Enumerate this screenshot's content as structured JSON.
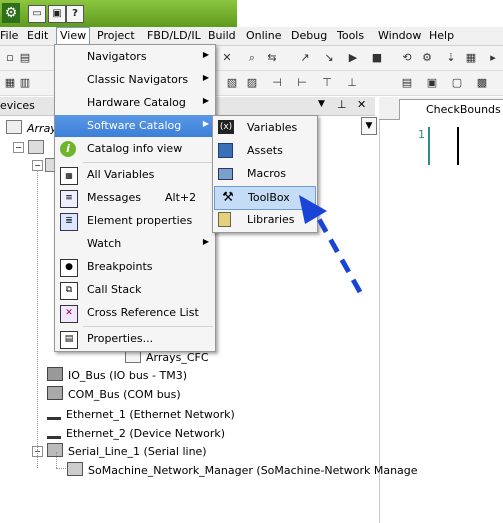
{
  "menubar": {
    "items": [
      "File",
      "Edit",
      "View",
      "Project",
      "FBD/LD/IL",
      "Build",
      "Online",
      "Debug",
      "Tools",
      "Window",
      "Help"
    ]
  },
  "devices_panel": {
    "title": "evices"
  },
  "editor": {
    "tab_label": "CheckBounds",
    "line_number": "1"
  },
  "tree": {
    "items": [
      {
        "label": "Array",
        "icon": "app-icon"
      },
      {
        "label": "Arrays_CFC",
        "icon": "pou-icon"
      },
      {
        "label": "IO_Bus (IO bus - TM3)",
        "icon": "io-bus-icon"
      },
      {
        "label": "COM_Bus (COM bus)",
        "icon": "com-bus-icon"
      },
      {
        "label": "Ethernet_1 (Ethernet Network)",
        "icon": "network-icon"
      },
      {
        "label": "Ethernet_2 (Device Network)",
        "icon": "network-icon"
      },
      {
        "label": "Serial_Line_1 (Serial line)",
        "icon": "serial-icon"
      },
      {
        "label": "SoMachine_Network_Manager (SoMachine-Network Manage",
        "icon": "network-manager-icon"
      }
    ]
  },
  "view_menu": {
    "items": [
      {
        "label": "Navigators",
        "submenu": true
      },
      {
        "label": "Classic Navigators",
        "submenu": true
      },
      {
        "label": "Hardware Catalog",
        "submenu": true
      },
      {
        "label": "Software Catalog",
        "submenu": true,
        "highlighted": true
      },
      {
        "label": "Catalog info view",
        "icon": "info-icon"
      },
      {
        "label": "All Variables",
        "icon": "variables-icon"
      },
      {
        "label": "Messages",
        "accel": "Alt+2",
        "icon": "messages-icon"
      },
      {
        "label": "Element properties",
        "icon": "properties-icon"
      },
      {
        "label": "Watch",
        "submenu": true
      },
      {
        "label": "Breakpoints",
        "icon": "breakpoints-icon"
      },
      {
        "label": "Call Stack",
        "icon": "callstack-icon"
      },
      {
        "label": "Cross Reference List",
        "icon": "crossref-icon"
      },
      {
        "label": "Properties...",
        "icon": "properties-dialog-icon"
      }
    ]
  },
  "software_catalog_menu": {
    "items": [
      {
        "label": "Variables",
        "icon": "variables-catalog-icon"
      },
      {
        "label": "Assets",
        "icon": "assets-icon"
      },
      {
        "label": "Macros",
        "icon": "macros-icon"
      },
      {
        "label": "ToolBox",
        "icon": "toolbox-icon",
        "highlighted": true
      },
      {
        "label": "Libraries",
        "icon": "libraries-icon"
      }
    ]
  },
  "colors": {
    "highlight": "#3c7fd8",
    "arrow": "#1a44d6",
    "title_green": "#6aab2a"
  }
}
